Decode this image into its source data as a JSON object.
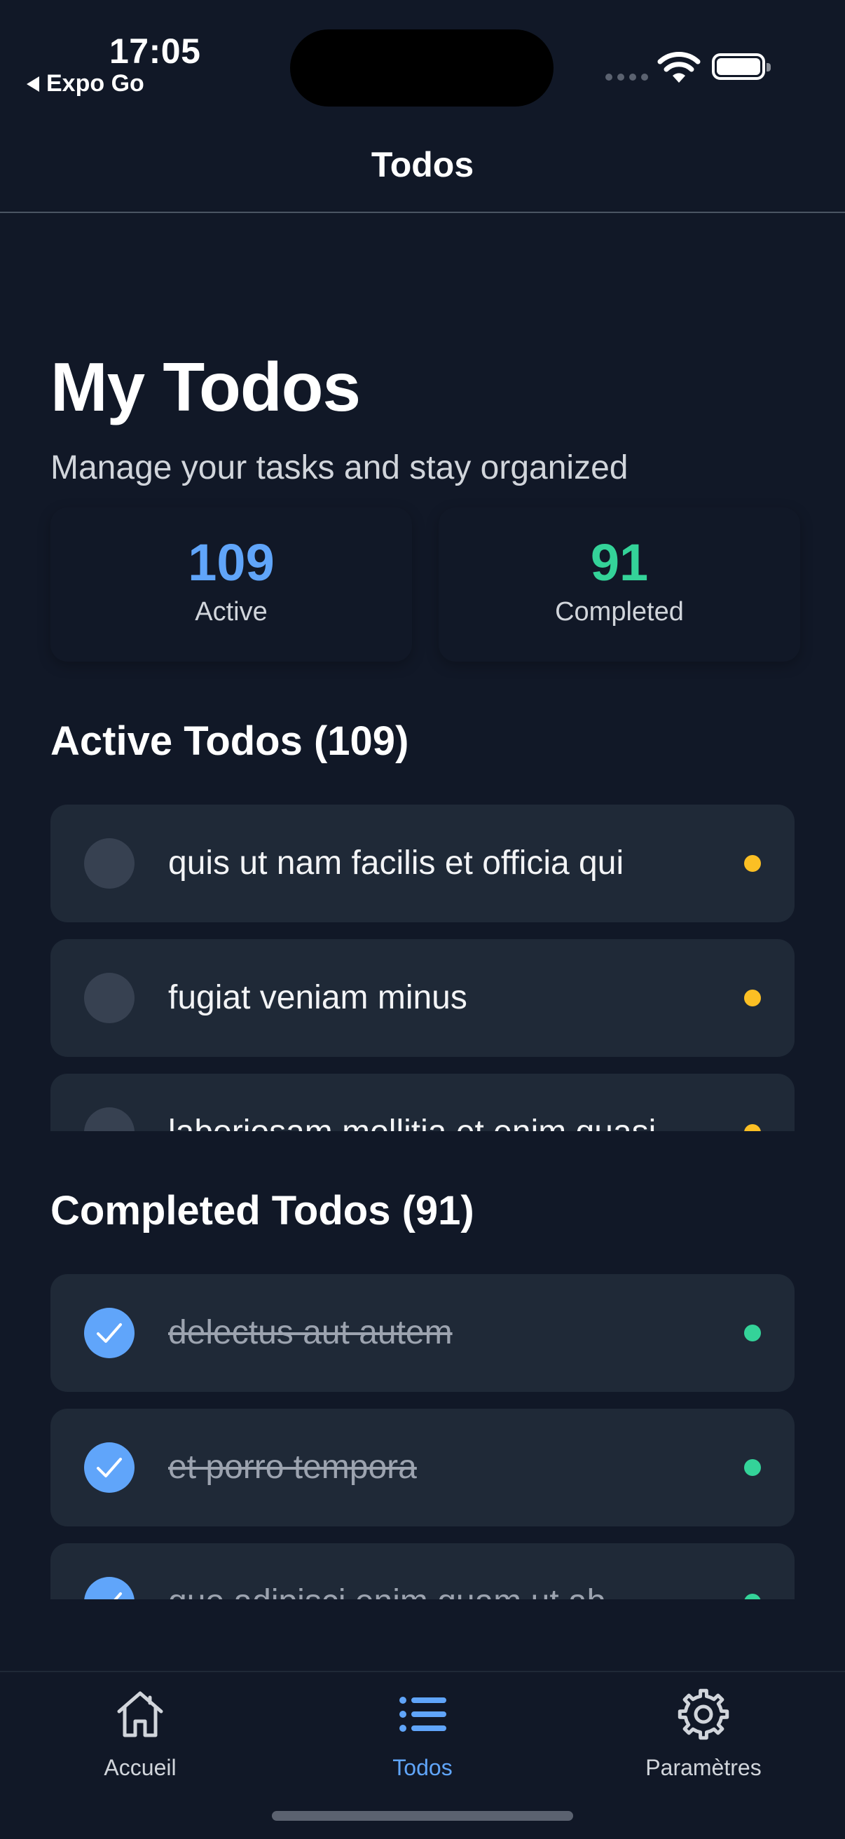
{
  "status_bar": {
    "time": "17:05",
    "back_app": "Expo Go"
  },
  "header": {
    "title": "Todos"
  },
  "hero": {
    "title": "My Todos",
    "subtitle": "Manage your tasks and stay organized"
  },
  "stats": [
    {
      "value": "109",
      "label": "Active",
      "color": "#60a5fa"
    },
    {
      "value": "91",
      "label": "Completed",
      "color": "#34d399"
    }
  ],
  "active_section": {
    "title": "Active Todos (109)",
    "items": [
      {
        "text": "quis ut nam facilis et officia qui",
        "dot_color": "#fbbf24"
      },
      {
        "text": "fugiat veniam minus",
        "dot_color": "#fbbf24"
      },
      {
        "text": "laboriosam mollitia et enim quasi",
        "dot_color": "#fbbf24"
      }
    ]
  },
  "completed_section": {
    "title": "Completed Todos (91)",
    "items": [
      {
        "text": "delectus aut autem",
        "dot_color": "#34d399"
      },
      {
        "text": "et porro tempora",
        "dot_color": "#34d399"
      },
      {
        "text": "quo adipisci enim quam ut ab",
        "dot_color": "#34d399"
      }
    ]
  },
  "tabbar": {
    "tabs": [
      {
        "label": "Accueil",
        "icon": "home-icon",
        "active": false
      },
      {
        "label": "Todos",
        "icon": "list-icon",
        "active": true
      },
      {
        "label": "Paramètres",
        "icon": "gear-icon",
        "active": false
      }
    ],
    "active_color": "#60a5fa",
    "inactive_color": "#d1d5db"
  }
}
